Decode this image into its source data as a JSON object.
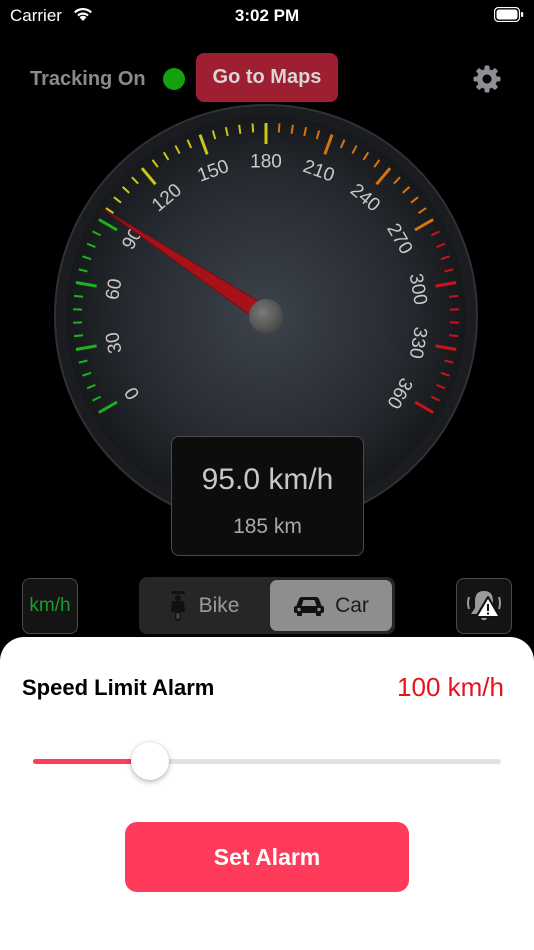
{
  "status_bar": {
    "carrier": "Carrier",
    "time": "3:02 PM"
  },
  "header": {
    "tracking_label": "Tracking On",
    "maps_button": "Go to Maps"
  },
  "gauge": {
    "min": 0,
    "max": 360,
    "labels": [
      "0",
      "30",
      "60",
      "90",
      "120",
      "150",
      "180",
      "210",
      "240",
      "270",
      "300",
      "330",
      "360"
    ],
    "needle_value": 95,
    "colors": {
      "green": "#1db31d",
      "yellow": "#c9c718",
      "orange": "#d9730d",
      "red": "#d0111c"
    }
  },
  "readout": {
    "speed": "95.0 km/h",
    "distance": "185 km"
  },
  "controls": {
    "unit_label": "km/h",
    "vehicle_options": [
      "Bike",
      "Car"
    ],
    "selected_vehicle": "Car"
  },
  "sheet": {
    "title": "Speed Limit Alarm",
    "limit_value": "100 km/h",
    "slider_fraction": 0.25,
    "button": "Set Alarm"
  },
  "colors": {
    "accent": "#ff3b5c",
    "maps_button": "#9e1f32",
    "tracking_dot": "#13a10e",
    "limit_text": "#e8121e"
  }
}
